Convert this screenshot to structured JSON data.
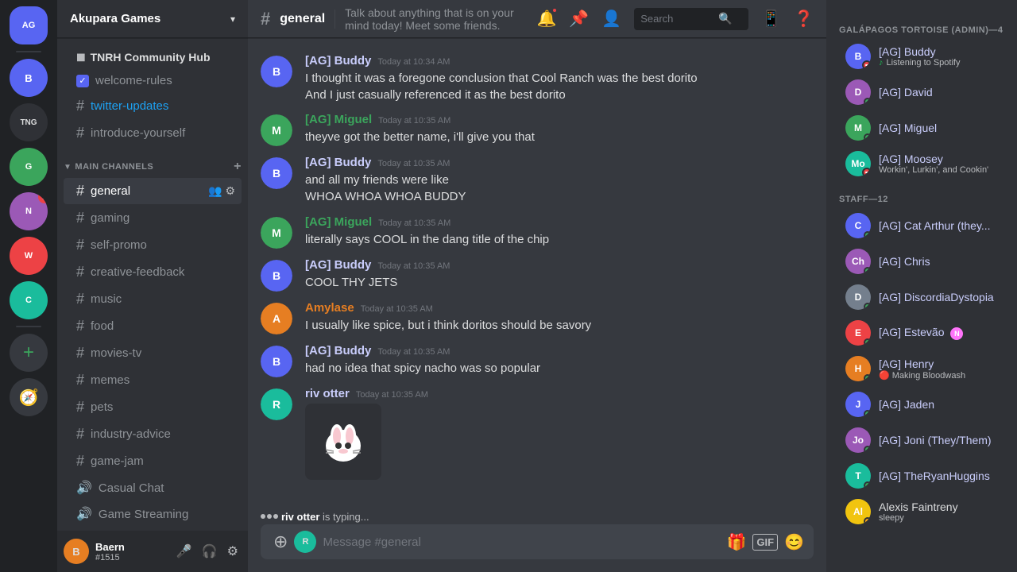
{
  "app": {
    "title": "Discord"
  },
  "server": {
    "name": "Akupara Games",
    "dropdown_label": "Akupara Games"
  },
  "community_hub": {
    "name": "TNRH Community Hub"
  },
  "top_channels": [
    {
      "type": "checkbox",
      "name": "welcome-rules",
      "checked": true
    },
    {
      "type": "text",
      "name": "twitter-updates",
      "active": false
    },
    {
      "type": "text",
      "name": "introduce-yourself",
      "active": false
    }
  ],
  "main_channels": {
    "label": "MAIN CHANNELS",
    "channels": [
      {
        "name": "general",
        "active": true
      },
      {
        "name": "gaming",
        "active": false
      },
      {
        "name": "self-promo",
        "active": false
      },
      {
        "name": "creative-feedback",
        "active": false
      },
      {
        "name": "music",
        "active": false
      },
      {
        "name": "food",
        "active": false
      },
      {
        "name": "movies-tv",
        "active": false
      },
      {
        "name": "memes",
        "active": false
      },
      {
        "name": "pets",
        "active": false
      },
      {
        "name": "industry-advice",
        "active": false
      },
      {
        "name": "game-jam",
        "active": false
      }
    ],
    "voice_channels": [
      {
        "name": "Casual Chat"
      },
      {
        "name": "Game Streaming"
      }
    ]
  },
  "channel_header": {
    "name": "general",
    "topic": "Talk about anything that is on your mind today! Meet some friends.",
    "search_placeholder": "Search"
  },
  "messages": [
    {
      "id": "msg1",
      "author": "[AG] Buddy",
      "author_color": "purple",
      "avatar_color": "av-blue",
      "avatar_letter": "B",
      "timestamp": "Today at 10:34 AM",
      "lines": [
        "I thought it was a foregone conclusion that Cool Ranch was the best dorito",
        "And I just casually referenced it as the best dorito"
      ]
    },
    {
      "id": "msg2",
      "author": "[AG] Miguel",
      "author_color": "green",
      "avatar_color": "av-green",
      "avatar_letter": "M",
      "timestamp": "Today at 10:35 AM",
      "lines": [
        "theyve got the better name, i'll give you that"
      ]
    },
    {
      "id": "msg3",
      "author": "[AG] Buddy",
      "author_color": "purple",
      "avatar_color": "av-blue",
      "avatar_letter": "B",
      "timestamp": "Today at 10:35 AM",
      "lines": [
        "and all my friends were like",
        "WHOA WHOA WHOA BUDDY"
      ]
    },
    {
      "id": "msg4",
      "author": "[AG] Miguel",
      "author_color": "green",
      "avatar_color": "av-green",
      "avatar_letter": "M",
      "timestamp": "Today at 10:35 AM",
      "lines": [
        "literally says COOL in the dang title of the chip"
      ]
    },
    {
      "id": "msg5",
      "author": "[AG] Buddy",
      "author_color": "purple",
      "avatar_color": "av-blue",
      "avatar_letter": "B",
      "timestamp": "Today at 10:35 AM",
      "lines": [
        "COOL THY JETS"
      ]
    },
    {
      "id": "msg6",
      "author": "Amylase",
      "author_color": "orange",
      "avatar_color": "av-orange",
      "avatar_letter": "A",
      "timestamp": "Today at 10:35 AM",
      "lines": [
        "I usually like spice, but i think doritos should be savory"
      ]
    },
    {
      "id": "msg7",
      "author": "[AG] Buddy",
      "author_color": "purple",
      "avatar_color": "av-blue",
      "avatar_letter": "B",
      "timestamp": "Today at 10:35 AM",
      "lines": [
        "had no idea that spicy nacho was so popular"
      ]
    },
    {
      "id": "msg8",
      "author": "riv otter",
      "author_color": "purple",
      "avatar_color": "av-teal",
      "avatar_letter": "R",
      "timestamp": "Today at 10:35 AM",
      "lines": [],
      "sticker": true,
      "sticker_emoji": "🦦"
    }
  ],
  "typing": {
    "user": "riv otter",
    "text": "is typing..."
  },
  "chat_input": {
    "placeholder": "Message #general"
  },
  "user_area": {
    "name": "Baern",
    "discriminator": "#1515",
    "avatar_letter": "B",
    "avatar_color": "av-orange"
  },
  "members_sidebar": {
    "sections": [
      {
        "header": "GALÁPAGOS TORTOISE (ADMIN)—4",
        "members": [
          {
            "name": "[AG] Buddy",
            "status": "dnd",
            "activity": "Listening to Spotify",
            "activity_icon": "spotify",
            "avatar_color": "av-blue",
            "letter": "B"
          },
          {
            "name": "[AG] David",
            "status": "online",
            "activity": "",
            "avatar_color": "av-purple",
            "letter": "D"
          },
          {
            "name": "[AG] Miguel",
            "status": "online",
            "activity": "",
            "avatar_color": "av-green",
            "letter": "M"
          },
          {
            "name": "[AG] Moosey",
            "status": "dnd",
            "activity": "Workin', Lurkin', and Cookin'",
            "avatar_color": "av-teal",
            "letter": "Mo"
          }
        ]
      },
      {
        "header": "STAFF—12",
        "members": [
          {
            "name": "[AG] Cat Arthur (they...",
            "status": "online",
            "activity": "",
            "avatar_color": "av-blue",
            "letter": "C"
          },
          {
            "name": "[AG] Chris",
            "status": "online",
            "activity": "",
            "avatar_color": "av-purple",
            "letter": "Ch"
          },
          {
            "name": "[AG] DiscordiaDystopia",
            "status": "online",
            "activity": "",
            "avatar_color": "av-gray",
            "letter": "D"
          },
          {
            "name": "[AG] Estevão",
            "status": "online",
            "activity": "",
            "avatar_color": "av-red",
            "letter": "E",
            "nitro": true
          },
          {
            "name": "[AG] Henry",
            "status": "online",
            "activity": "Making Bloodwash",
            "activity_prefix": "🔴",
            "avatar_color": "av-orange",
            "letter": "H"
          },
          {
            "name": "[AG] Jaden",
            "status": "online",
            "activity": "",
            "avatar_color": "av-blue",
            "letter": "J"
          },
          {
            "name": "[AG] Joni (They/Them)",
            "status": "online",
            "activity": "",
            "avatar_color": "av-purple",
            "letter": "Jo"
          },
          {
            "name": "[AG] TheRyanHuggins",
            "status": "online",
            "activity": "",
            "avatar_color": "av-teal",
            "letter": "T"
          },
          {
            "name": "Alexis Faintreny",
            "status": "idle",
            "activity": "sleepy",
            "avatar_color": "av-yellow",
            "letter": "Al"
          }
        ]
      }
    ]
  },
  "server_icons": [
    {
      "letter": "B",
      "color": "av-blue",
      "active": false
    },
    {
      "letter": "TNG",
      "color": "av-dark",
      "active": false
    },
    {
      "letter": "G",
      "color": "av-green",
      "active": false
    },
    {
      "letter": "N",
      "color": "av-purple",
      "active": false
    },
    {
      "letter": "AG",
      "color": "av-red",
      "active": true
    },
    {
      "letter": "W",
      "color": "av-blue",
      "active": false
    },
    {
      "letter": "C",
      "color": "av-teal",
      "active": false
    }
  ]
}
